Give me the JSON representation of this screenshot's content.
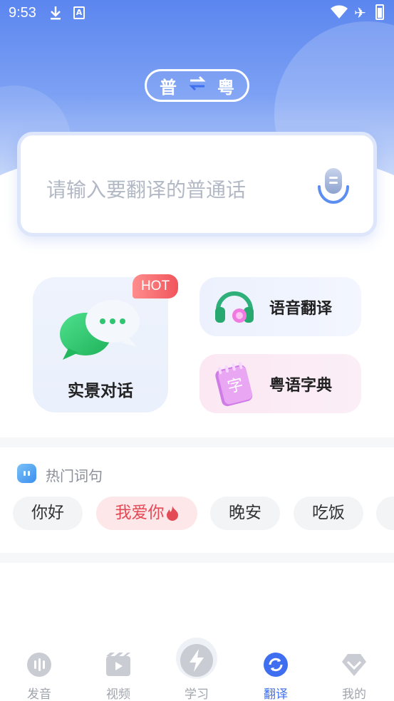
{
  "status_bar": {
    "time": "9:53"
  },
  "header": {
    "source_lang": "普",
    "target_lang": "粤",
    "swap_icon": "swap-arrows-icon"
  },
  "input": {
    "placeholder": "请输入要翻译的普通话",
    "mic_icon": "microphone-icon"
  },
  "features": {
    "scene_dialog": {
      "label": "实景对话",
      "badge": "HOT"
    },
    "voice_translate": {
      "label": "语音翻译"
    },
    "cantonese_dict": {
      "label": "粤语字典"
    }
  },
  "hot_phrases": {
    "title": "热门词句",
    "items": [
      "你好",
      "我爱你",
      "晚安",
      "吃饭"
    ],
    "hot_index": 1
  },
  "tabbar": {
    "items": [
      {
        "label": "发音",
        "icon": "pronunciation-icon"
      },
      {
        "label": "视频",
        "icon": "video-icon"
      },
      {
        "label": "学习",
        "icon": "lightning-icon"
      },
      {
        "label": "翻译",
        "icon": "translate-refresh-icon",
        "active": true
      },
      {
        "label": "我的",
        "icon": "diamond-icon"
      }
    ]
  },
  "colors": {
    "primary": "#3f6ff0",
    "hot": "#e34a55",
    "header_gradient_top": "#5b86ef"
  }
}
